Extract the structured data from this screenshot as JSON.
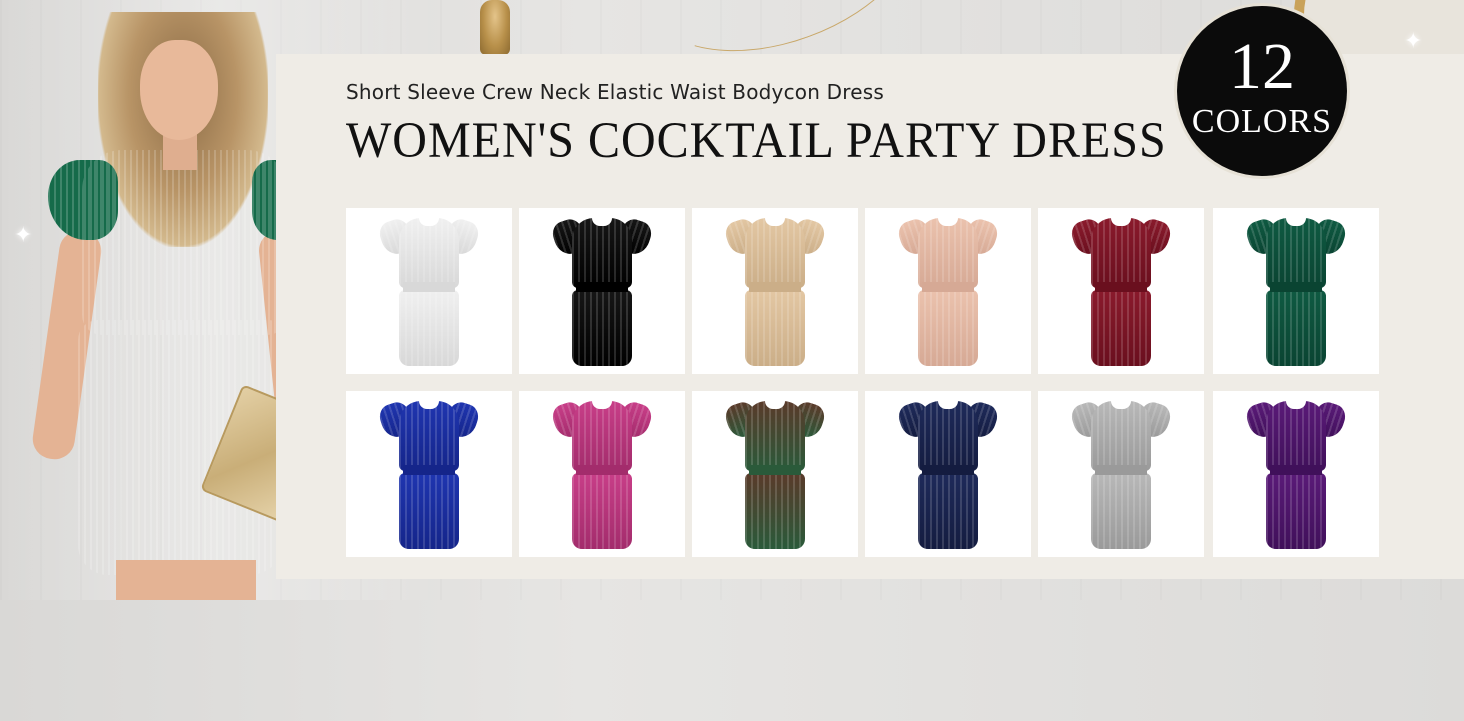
{
  "banner": {
    "subtitle": "Short Sleeve Crew Neck Elastic Waist Bodycon Dress",
    "title": "WOMEN'S COCKTAIL PARTY DRESS",
    "badge": {
      "number": "12",
      "word": "COLORS"
    }
  },
  "swatches": [
    {
      "color": "#f0f0f0",
      "shade": "#d8d8d8"
    },
    {
      "color": "#161616",
      "shade": "#000000"
    },
    {
      "color": "#e3c7a3",
      "shade": "#cbae88"
    },
    {
      "color": "#ebc2ad",
      "shade": "#d6a995"
    },
    {
      "color": "#8a1a2c",
      "shade": "#6a0f1e"
    },
    {
      "color": "#0f5a42",
      "shade": "#0a4432"
    },
    {
      "color": "#1f35b0",
      "shade": "#15258a"
    },
    {
      "color": "#c83e88",
      "shade": "#a32c6c"
    },
    {
      "color": "#5a3a2a",
      "shade": "#2a5a3a"
    },
    {
      "color": "#1e2a5a",
      "shade": "#141c40"
    },
    {
      "color": "#b8b8b8",
      "shade": "#9a9a9a"
    },
    {
      "color": "#5a1a78",
      "shade": "#40105a"
    }
  ]
}
